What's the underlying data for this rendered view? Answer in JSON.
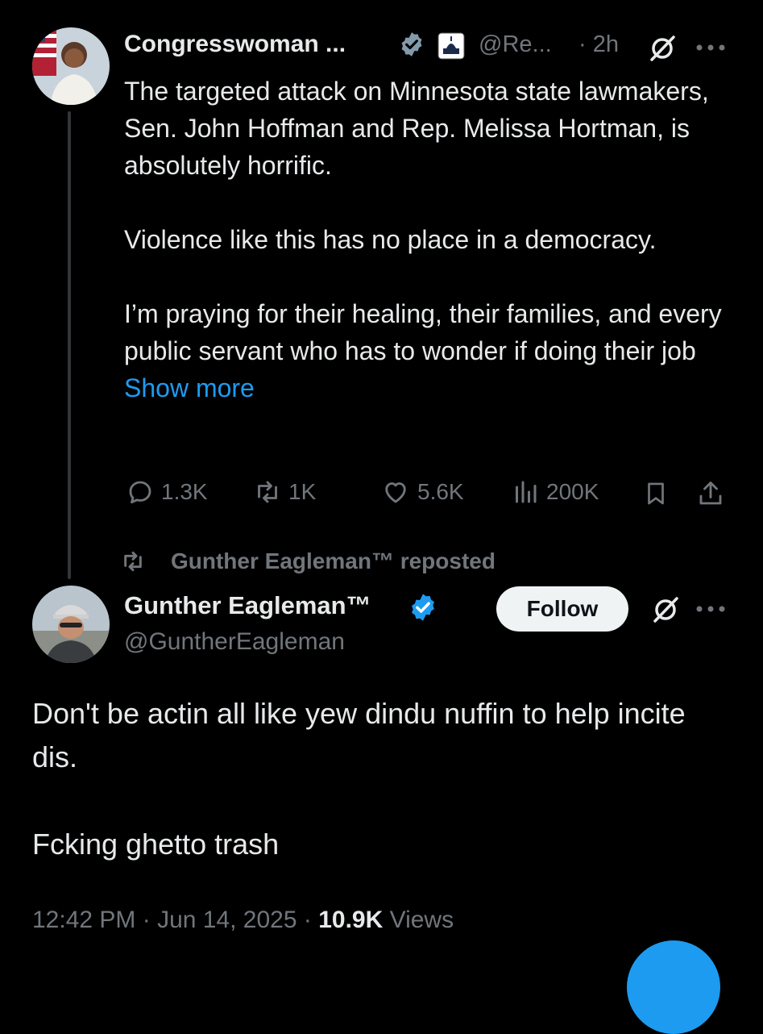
{
  "quoted_tweet": {
    "display_name": "Congresswoman ...",
    "handle": "@Re...",
    "time": "· 2h",
    "text_paragraphs": [
      "The targeted attack on Minnesota state lawmakers, Sen. John Hoffman and Rep. Melissa Hortman, is absolutely horrific.",
      "Violence like this has no place in a democracy.",
      "I’m praying for their healing, their families, and every public servant who has to wonder if doing their job"
    ],
    "show_more": "Show more",
    "stats": {
      "replies": "1.3K",
      "reposts": "1K",
      "likes": "5.6K",
      "views": "200K"
    }
  },
  "repost_banner": {
    "text": "Gunther Eagleman™ reposted"
  },
  "main_tweet": {
    "display_name": "Gunther Eagleman™",
    "handle": "@GuntherEagleman",
    "follow_label": "Follow",
    "text_paragraphs": [
      "Don't be actin all like yew dindu nuffin to help incite dis.",
      "Fcking ghetto trash"
    ],
    "timestamp": "12:42 PM · Jun 14, 2025 · ",
    "views_count": "10.9K",
    "views_label": " Views"
  },
  "colors": {
    "background": "#000000",
    "text": "#e7e9ea",
    "muted": "#71767b",
    "link": "#1d9bf0",
    "verified_badge_quoted": "#829aab",
    "verified_badge_main": "#1d9bf0"
  },
  "icons": {
    "verified": "verified-badge-icon",
    "affiliation": "capitol-building-icon",
    "grok": "grok-icon",
    "more": "more-icon",
    "reply": "reply-icon",
    "repost": "repost-icon",
    "like": "heart-icon",
    "views": "views-icon",
    "bookmark": "bookmark-icon",
    "share": "share-icon"
  }
}
